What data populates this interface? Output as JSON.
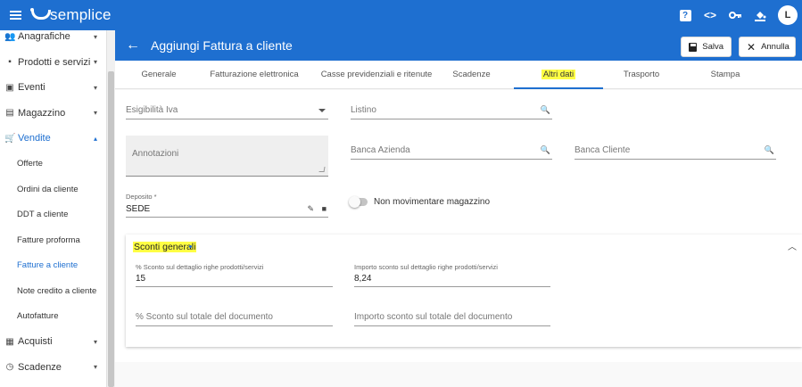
{
  "app": {
    "name": "semplice",
    "user_initial": "L",
    "accent_color": "#1e6fd0",
    "highlight_color": "#ffff44"
  },
  "topbar": {
    "icons": [
      "menu-icon",
      "help-icon",
      "code-icon",
      "key-icon",
      "format-paint-icon"
    ],
    "help_label": "?",
    "code_label": "<>"
  },
  "sidebar": {
    "items": [
      {
        "label": "Anagrafiche",
        "icon": "people-icon"
      },
      {
        "label": "Prodotti e servizi",
        "icon": "box-icon"
      },
      {
        "label": "Eventi",
        "icon": "calendar-icon"
      },
      {
        "label": "Magazzino",
        "icon": "store-icon"
      },
      {
        "label": "Vendite",
        "icon": "cart-icon"
      },
      {
        "label": "Acquisti",
        "icon": "receipt-icon"
      },
      {
        "label": "Scadenze",
        "icon": "clock-icon"
      }
    ],
    "vendite_sub": [
      "Offerte",
      "Ordini da cliente",
      "DDT a cliente",
      "Fatture proforma",
      "Fatture a cliente",
      "Note credito a cliente",
      "Autofatture"
    ]
  },
  "header": {
    "title": "Aggiungi Fattura a cliente",
    "save_label": "Salva",
    "cancel_label": "Annulla"
  },
  "tabs": [
    "Generale",
    "Fatturazione elettronica",
    "Casse previdenziali e ritenute",
    "Scadenze",
    "Altri dati",
    "Trasporto",
    "Stampa"
  ],
  "active_tab": "Altri dati",
  "form": {
    "esigibilita_placeholder": "Esigibilità Iva",
    "listino_placeholder": "Listino",
    "annotazioni_placeholder": "Annotazioni",
    "banca_azienda_placeholder": "Banca Azienda",
    "banca_cliente_placeholder": "Banca Cliente",
    "deposito_label": "Deposito *",
    "deposito_value": "SEDE",
    "toggle_label": "Non movimentare magazzino",
    "toggle_on": false
  },
  "sconti": {
    "title": "Sconti generali",
    "sconto_righe_label": "% Sconto sul dettaglio righe prodotti/servizi",
    "sconto_righe_value": "15",
    "importo_righe_label": "Importo sconto sul dettaglio righe prodotti/servizi",
    "importo_righe_value": "8,24",
    "sconto_totale_placeholder": "% Sconto sul totale del documento",
    "importo_totale_placeholder": "Importo sconto sul totale del documento"
  }
}
